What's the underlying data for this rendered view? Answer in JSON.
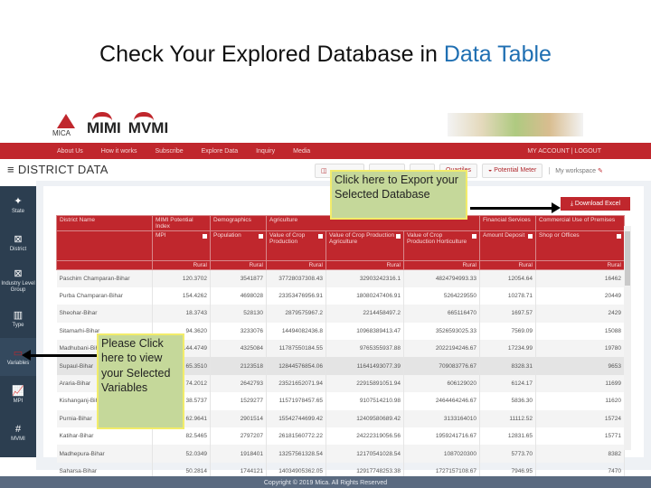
{
  "slide": {
    "title_pre": "Check Your Explored Database in ",
    "title_hl": "Data Table"
  },
  "logos": {
    "mica": "MICA",
    "mimi": "MIMI",
    "mvmi": "MVMI"
  },
  "nav": {
    "left": [
      "About Us",
      "How it works",
      "Subscribe",
      "Explore Data",
      "Inquiry",
      "Media"
    ],
    "right": "MY ACCOUNT | LOGOUT"
  },
  "page": {
    "title": "DISTRICT DATA",
    "menu_icon": "hamburger-icon"
  },
  "toolbar": {
    "quartiles": "Quartiles",
    "potential_meter": "Potential Meter",
    "workspace": "My workspace"
  },
  "sidebar": [
    {
      "icon": "india-map-icon",
      "label": "State"
    },
    {
      "icon": "district-icon",
      "label": "District"
    },
    {
      "icon": "industry-icon",
      "label": "Industry Level Group"
    },
    {
      "icon": "type-icon",
      "label": "Type"
    },
    {
      "icon": "variables-icon",
      "label": "Variables"
    },
    {
      "icon": "mpi-chart-icon",
      "label": "MPI"
    },
    {
      "icon": "hash-icon",
      "label": "MVMI"
    }
  ],
  "download_label": "Download Excel",
  "table": {
    "groups": [
      "District Name",
      "MIMI Potential Index",
      "Demographics",
      "Agriculture",
      "Financial Services",
      "Commercial Use of Premises"
    ],
    "columns": [
      "MPI",
      "Population",
      "Value of Crop Production",
      "Value of Crop Production Agriculture",
      "Value of Crop Production Horticulture",
      "Amount Deposit",
      "Shop or Offices"
    ],
    "sub": "Rural",
    "rows": [
      [
        "Paschim Champaran-Bihar",
        "120.3702",
        "3541877",
        "37728037308.43",
        "32903242316.1",
        "4824794993.33",
        "12054.64",
        "16462"
      ],
      [
        "Purba Champaran-Bihar",
        "154.4262",
        "4698028",
        "23353476956.91",
        "18080247406.91",
        "5264229550",
        "10278.71",
        "20449"
      ],
      [
        "Sheohar-Bihar",
        "18.3743",
        "528130",
        "2879575967.2",
        "2214458497.2",
        "665116470",
        "1697.57",
        "2429"
      ],
      [
        "Sitamarhi-Bihar",
        "94.3620",
        "3233076",
        "14494082436.8",
        "10968389413.47",
        "3526593025.33",
        "7569.09",
        "15088"
      ],
      [
        "Madhubani-Bihar",
        "144.4749",
        "4325084",
        "11787550184.55",
        "9765355937.88",
        "2022194246.67",
        "17234.99",
        "19780"
      ],
      [
        "Supaul-Bihar",
        "65.3510",
        "2123518",
        "12844576854.06",
        "11641493077.39",
        "709083776.67",
        "8328.31",
        "9653"
      ],
      [
        "Araria-Bihar",
        "74.2012",
        "2642793",
        "23521652071.94",
        "22915891051.94",
        "606129020",
        "6124.17",
        "11699"
      ],
      [
        "Kishanganj-Bihar",
        "38.5737",
        "1529277",
        "11571978457.65",
        "9107514210.98",
        "2464464246.67",
        "5836.30",
        "11620"
      ],
      [
        "Purnia-Bihar",
        "62.9641",
        "2901514",
        "15542744699.42",
        "12409580689.42",
        "3133164010",
        "11112.52",
        "15724"
      ],
      [
        "Katihar-Bihar",
        "82.5465",
        "2797207",
        "26181560772.22",
        "24222319056.56",
        "1959241716.67",
        "12831.65",
        "15771"
      ],
      [
        "Madhepura-Bihar",
        "52.0349",
        "1918401",
        "13257561328.54",
        "12170541028.54",
        "1087020300",
        "5773.70",
        "8382"
      ],
      [
        "Saharsa-Bihar",
        "50.2814",
        "1744121",
        "14034905362.05",
        "12917748253.38",
        "1727157108.67",
        "7946.95",
        "7470"
      ]
    ]
  },
  "footer": "Copyright © 2019 Mica. All Rights Reserved",
  "callouts": {
    "export": "Click  here to  Export your  Selected Database",
    "variables": "Please Click here to view your Selected Variables"
  },
  "colors": {
    "brand_red": "#c0272d",
    "sidebar": "#2c3e50",
    "callout": "#c5d89a",
    "title_accent": "#1f6fb2"
  }
}
